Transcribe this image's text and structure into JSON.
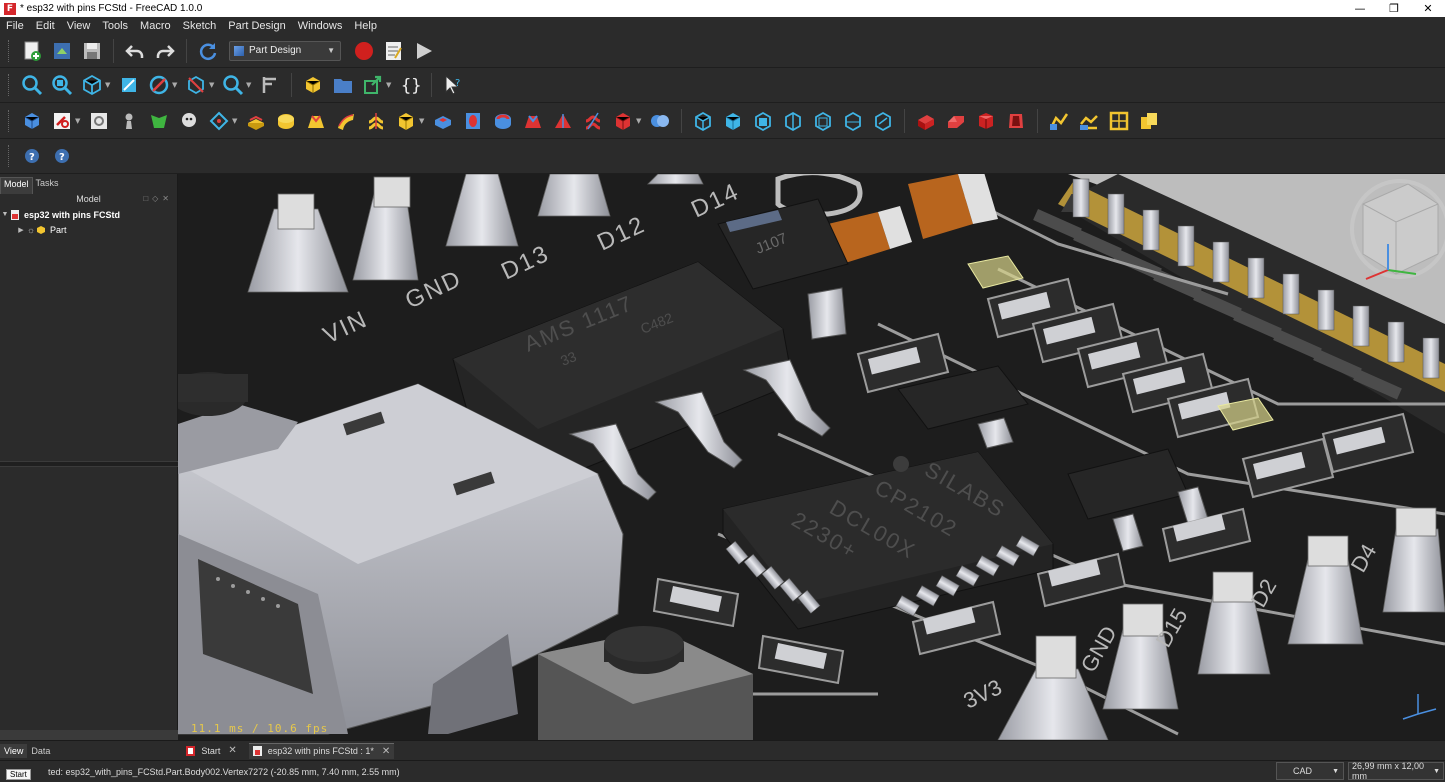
{
  "window": {
    "title": "* esp32 with pins FCStd - FreeCAD 1.0.0",
    "app_icon": "freecad-icon"
  },
  "menubar": [
    "File",
    "Edit",
    "View",
    "Tools",
    "Macro",
    "Sketch",
    "Part Design",
    "Windows",
    "Help"
  ],
  "workbench": {
    "selected": "Part Design"
  },
  "left_panel": {
    "tabs": [
      "Model",
      "Tasks"
    ],
    "active_tab": "Model",
    "tree_header": "Model",
    "tree": [
      {
        "label": "esp32 with pins FCStd",
        "icon": "document-icon",
        "expanded": true
      },
      {
        "label": "Part",
        "icon": "part-icon",
        "expanded": false
      }
    ]
  },
  "viewport": {
    "fps_text": "11.1 ms / 10.6 fps",
    "silkscreen": {
      "pins": [
        "VIN",
        "GND",
        "D13",
        "D12",
        "D14"
      ],
      "ams": "AMS 1117",
      "ams_sub1": "33",
      "ams_sub2": "C482",
      "cp_line1": "SILABS",
      "cp_line2": "CP2102",
      "cp_line3": "DCL00X",
      "cp_line4": "2230+",
      "bottom_labels": [
        "D15",
        "D2",
        "D4",
        "3V3",
        "GND"
      ],
      "j107": "J107"
    },
    "colors": {
      "pcb": "#1f1f1f",
      "trace": "#9c9c9c",
      "pad_gold": "#c8a13a",
      "cap_orange": "#b8651e",
      "selection": "#d8d48a"
    }
  },
  "bottom_tabs": {
    "panel_tabs": [
      "View",
      "Data"
    ],
    "active_panel_tab": "View",
    "documents": [
      {
        "label": "Start",
        "closable": true
      },
      {
        "label": "esp32 with pins FCStd : 1*",
        "closable": true
      }
    ]
  },
  "statusbar": {
    "text": "ted: esp32_with_pins_FCStd.Part.Body002.Vertex7272 (-20.85 mm, 7.40 mm, 2.55 mm)",
    "tooltip": "Start",
    "navigation_style": "CAD",
    "dimensions": "26,99 mm x 12,00 mm"
  }
}
